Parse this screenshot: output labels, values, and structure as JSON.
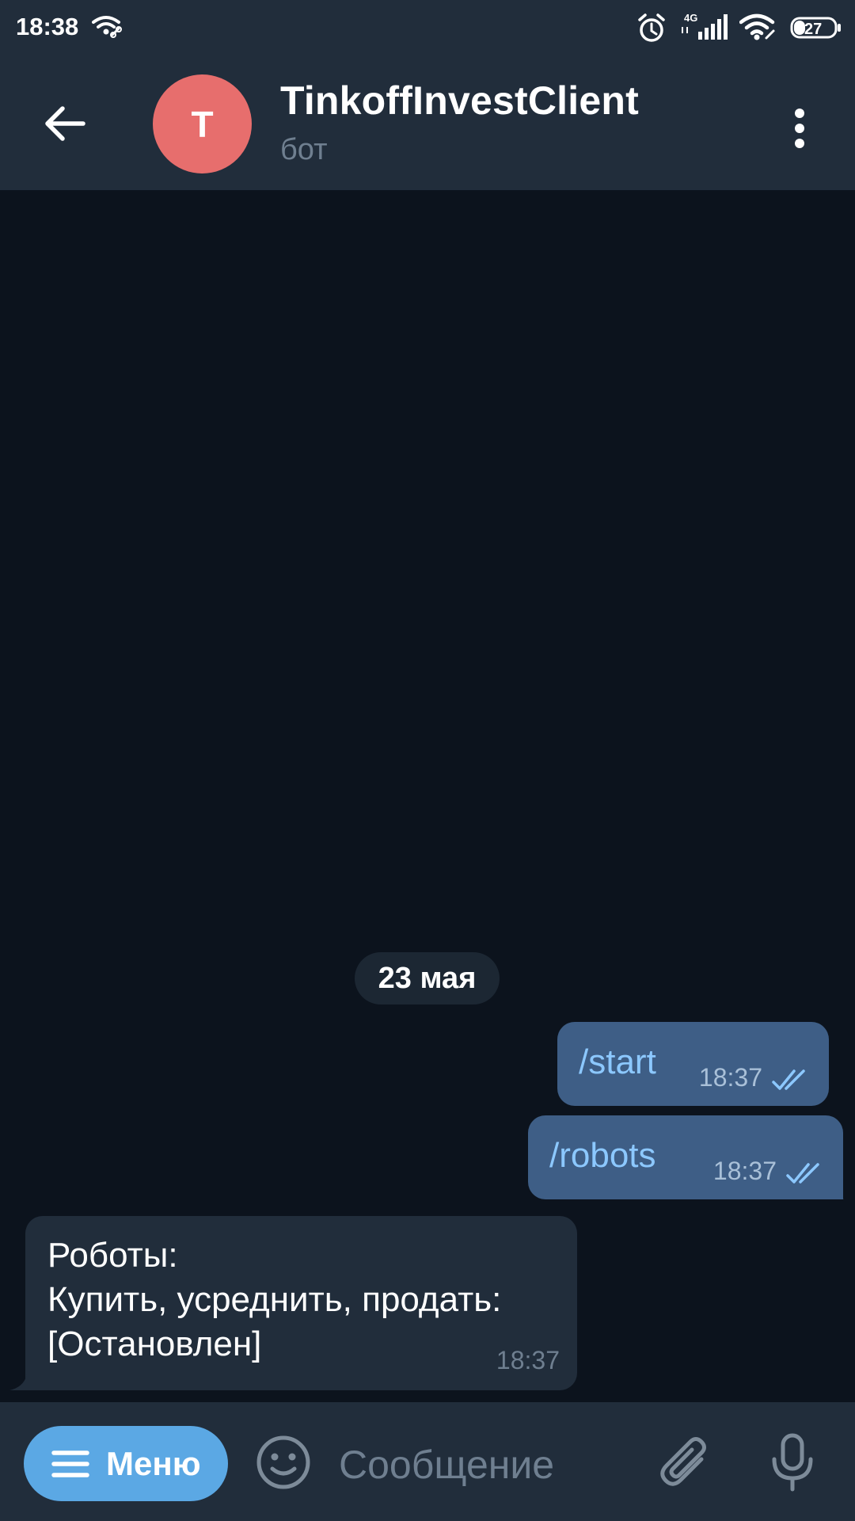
{
  "status_bar": {
    "time": "18:38",
    "network": "4G",
    "battery": "27",
    "icons": [
      "wifi-link-icon",
      "alarm-icon",
      "signal-icon",
      "wifi-icon",
      "battery-icon"
    ]
  },
  "header": {
    "avatar_letter": "T",
    "title": "TinkoffInvestClient",
    "subtitle": "бот",
    "avatar_color": "#e76e6d"
  },
  "chat": {
    "date": "23 мая",
    "messages": [
      {
        "direction": "out",
        "text": "/start",
        "time": "18:37",
        "status": "read"
      },
      {
        "direction": "out",
        "text": "/robots",
        "time": "18:37",
        "status": "read"
      },
      {
        "direction": "in",
        "lines": [
          "Роботы:",
          "Купить, усреднить, продать:",
          "[Остановлен]"
        ],
        "time": "18:37"
      }
    ]
  },
  "input_bar": {
    "menu_label": "Меню",
    "placeholder": "Сообщение",
    "value": ""
  },
  "colors": {
    "background": "#0c131d",
    "header": "#212d3b",
    "outgoing_bubble": "#3e5e86",
    "incoming_bubble": "#212d3b",
    "accent": "#5ba8e4"
  }
}
